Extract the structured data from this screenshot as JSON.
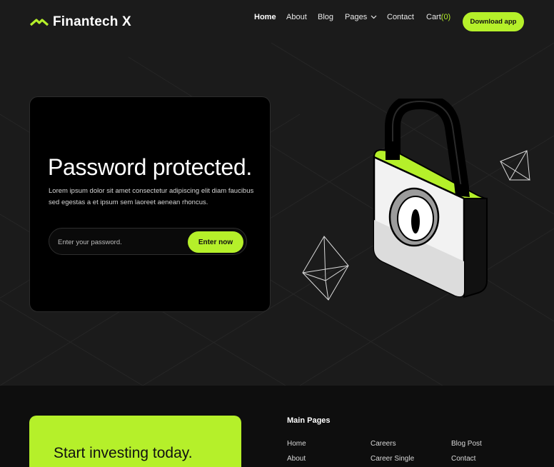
{
  "brand": {
    "name": "Finantech X",
    "accent": "#b5f02a",
    "background": "#1b1b1b"
  },
  "nav": {
    "home": "Home",
    "about": "About",
    "blog": "Blog",
    "pages": "Pages",
    "contact": "Contact",
    "cart": "Cart",
    "cart_count": "(0)",
    "download": "Download app"
  },
  "card": {
    "title": "Password protected.",
    "description": "Lorem ipsum dolor sit amet consectetur adipiscing elit diam faucibus sed egestas a et ipsum sem laoreet aenean rhoncus.",
    "password_placeholder": "Enter your password.",
    "submit_label": "Enter now"
  },
  "footer": {
    "cta_title": "Start investing today.",
    "main_pages_heading": "Main Pages",
    "links_col1": [
      "Home",
      "About"
    ],
    "links_col2": [
      "Careers",
      "Career Single"
    ],
    "links_col3": [
      "Blog Post",
      "Contact"
    ]
  },
  "icons": {
    "logo": "chevron-up-logo-icon",
    "dropdown": "chevron-down-icon",
    "illustration": "padlock-illustration",
    "shapes": [
      "octahedron-outline-icon",
      "tetrahedron-outline-icon"
    ]
  }
}
